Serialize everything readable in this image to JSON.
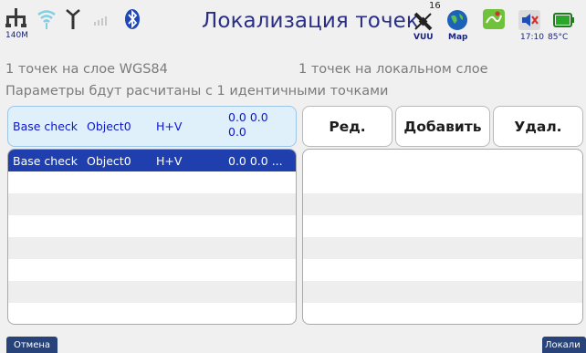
{
  "status": {
    "title": "Локализация точек",
    "memory_label": "140M",
    "satellite_count": "16",
    "source_label": "VUU",
    "map_label": "Map",
    "time": "17:10",
    "temperature": "85°C"
  },
  "info": {
    "line1_left": "1 точек на слое WGS84",
    "line1_right": "1 точек на локальном слое",
    "line2": "Параметры бдут расчитаны с 1 идентичными точками"
  },
  "selected_summary": {
    "name": "Base check",
    "object": "Object0",
    "type": "H+V",
    "value_line1": "0.0 0.0",
    "value_line2": "0.0"
  },
  "buttons": {
    "edit": "Ред.",
    "add": "Добавить",
    "delete": "Удал."
  },
  "left_list": [
    {
      "name": "Base check",
      "object": "Object0",
      "type": "H+V",
      "value": "0.0 0.0 ..."
    }
  ],
  "footer": {
    "cancel": "Отмена",
    "localize": "Локали"
  },
  "colors": {
    "title": "#2a2f86",
    "selected_row": "#1f3fae",
    "summary_bg": "#dff0fb",
    "footer_button": "#27437a"
  }
}
